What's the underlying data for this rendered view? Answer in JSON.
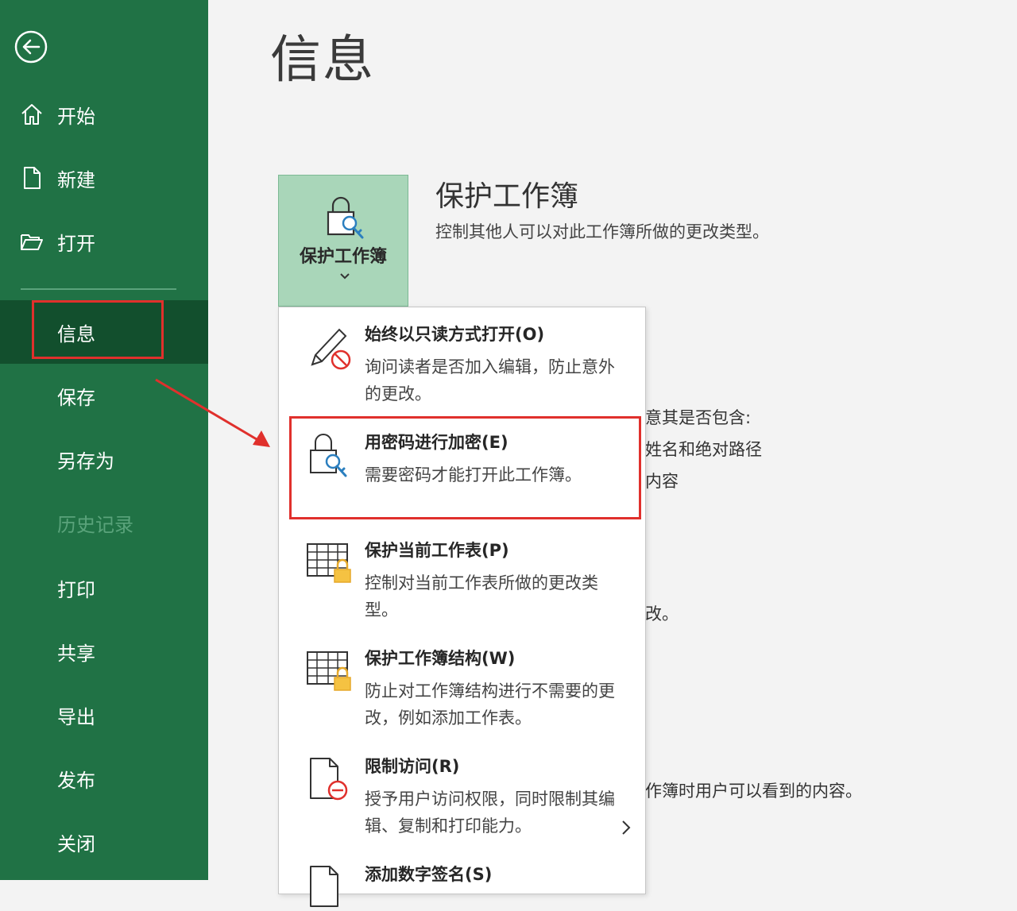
{
  "sidebar": {
    "nav": {
      "home": "开始",
      "new": "新建",
      "open": "打开",
      "info": "信息",
      "save": "保存",
      "save_as": "另存为",
      "history": "历史记录",
      "print": "打印",
      "share": "共享",
      "export": "导出",
      "publish": "发布",
      "close": "关闭"
    }
  },
  "main": {
    "title": "信息",
    "protect_button_label": "保护工作簿",
    "section_title": "保护工作簿",
    "section_desc": "控制其他人可以对此工作簿所做的更改类型。",
    "partial_text": {
      "line1": "意其是否包含:",
      "line2": "姓名和绝对路径",
      "line3": "内容",
      "line4": "改。",
      "line5": "作簿时用户可以看到的内容。"
    }
  },
  "menu": {
    "items": [
      {
        "title": "始终以只读方式打开(O)",
        "desc": "询问读者是否加入编辑，防止意外的更改。"
      },
      {
        "title": "用密码进行加密(E)",
        "desc": "需要密码才能打开此工作簿。"
      },
      {
        "title": "保护当前工作表(P)",
        "desc": "控制对当前工作表所做的更改类型。"
      },
      {
        "title": "保护工作簿结构(W)",
        "desc": "防止对工作簿结构进行不需要的更改，例如添加工作表。"
      },
      {
        "title": "限制访问(R)",
        "desc": "授予用户访问权限，同时限制其编辑、复制和打印能力。"
      },
      {
        "title": "添加数字签名(S)",
        "desc": ""
      }
    ]
  },
  "colors": {
    "sidebar_bg": "#207245",
    "sidebar_selected": "#124f2d",
    "highlight": "#e0302c",
    "protect_button_bg": "#a9d6b9"
  }
}
